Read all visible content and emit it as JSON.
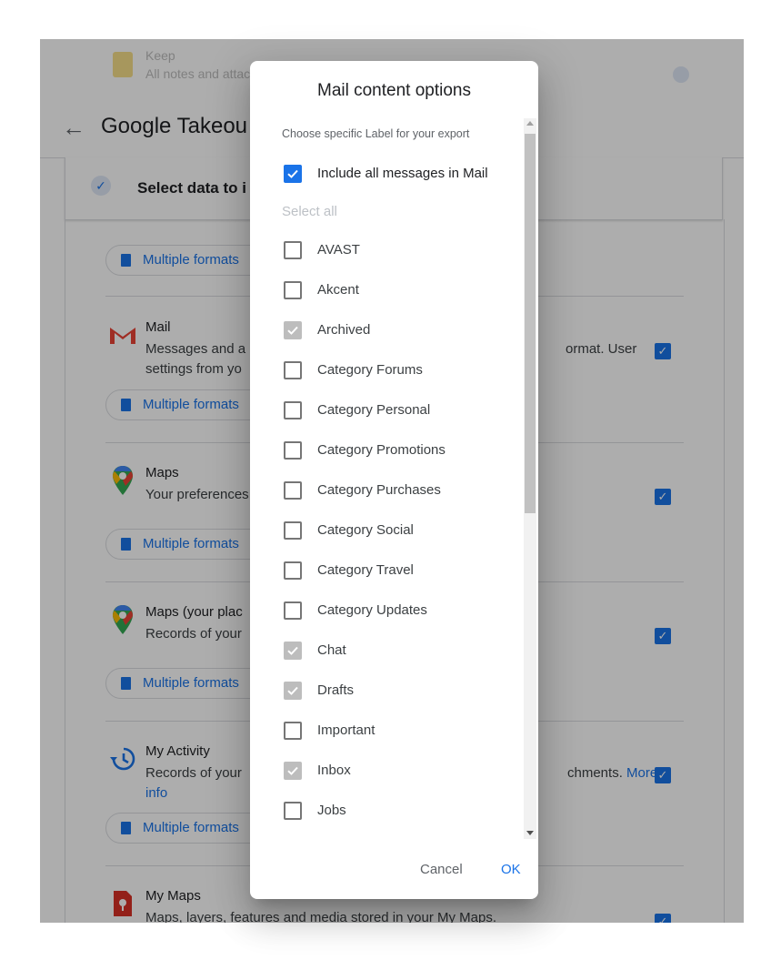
{
  "background": {
    "page_title": "Google Takeou",
    "back_icon": "arrow-back-icon",
    "faded_row": {
      "title": "Keep",
      "description": "All notes and attachments"
    },
    "step_title": "Select data to i",
    "format_button_label": "Multiple formats",
    "products": [
      {
        "name": "Mail",
        "icon": "gmail-icon",
        "description_left": "Messages and a",
        "description_right": "ormat. User",
        "description_line2": "settings from yo",
        "checked": true
      },
      {
        "name": "Maps",
        "icon": "maps-pin-icon",
        "description_left": "Your preferences",
        "description_right": "",
        "checked": true
      },
      {
        "name": "Maps (your plac",
        "icon": "maps-pin-icon",
        "description_left": "Records of your",
        "description_right": "",
        "checked": true
      },
      {
        "name": "My Activity",
        "icon": "history-icon",
        "description_left": "Records of your",
        "description_right": "chments.",
        "more_info_1": "More",
        "more_info_2": "info",
        "checked": true
      },
      {
        "name": "My Maps",
        "icon": "my-maps-icon",
        "description_left": "Maps, layers, features and media stored in your My Maps.",
        "checked": true
      }
    ]
  },
  "dialog": {
    "title": "Mail content options",
    "subtitle": "Choose specific Label for your export",
    "include_all_label": "Include all messages in Mail",
    "include_all_checked": true,
    "select_all_label": "Select all",
    "labels": [
      {
        "name": "AVAST",
        "state": "unchecked"
      },
      {
        "name": "Akcent",
        "state": "unchecked"
      },
      {
        "name": "Archived",
        "state": "checked-disabled"
      },
      {
        "name": "Category Forums",
        "state": "unchecked"
      },
      {
        "name": "Category Personal",
        "state": "unchecked"
      },
      {
        "name": "Category Promotions",
        "state": "unchecked"
      },
      {
        "name": "Category Purchases",
        "state": "unchecked"
      },
      {
        "name": "Category Social",
        "state": "unchecked"
      },
      {
        "name": "Category Travel",
        "state": "unchecked"
      },
      {
        "name": "Category Updates",
        "state": "unchecked"
      },
      {
        "name": "Chat",
        "state": "checked-disabled"
      },
      {
        "name": "Drafts",
        "state": "checked-disabled"
      },
      {
        "name": "Important",
        "state": "unchecked"
      },
      {
        "name": "Inbox",
        "state": "checked-disabled"
      },
      {
        "name": "Jobs",
        "state": "unchecked"
      }
    ],
    "cancel_label": "Cancel",
    "ok_label": "OK"
  },
  "colors": {
    "accent": "#1a73e8",
    "disabled_check": "#bdbdbd",
    "scrim": "rgba(0,0,0,0.32)"
  }
}
